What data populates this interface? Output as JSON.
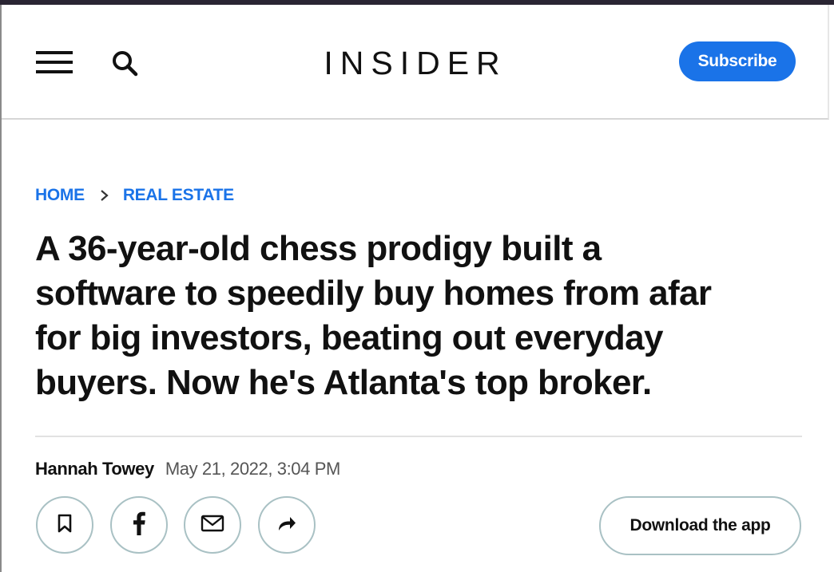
{
  "header": {
    "logo_text": "INSIDER",
    "subscribe_label": "Subscribe",
    "menu_icon": "hamburger-menu-icon",
    "search_icon": "search-icon"
  },
  "breadcrumb": {
    "items": [
      {
        "label": "HOME"
      },
      {
        "label": "REAL ESTATE"
      }
    ],
    "separator_icon": "chevron-right-icon"
  },
  "article": {
    "headline_lines": [
      "A 36-year-old chess prodigy built a",
      "software to speedily buy homes from afar",
      "for big investors, beating out everyday",
      "buyers. Now he's Atlanta's top broker."
    ],
    "author": "Hannah Towey",
    "date": "May 21, 2022, 3:04 PM"
  },
  "actions": {
    "buttons": [
      {
        "icon": "bookmark-icon"
      },
      {
        "icon": "facebook-icon"
      },
      {
        "icon": "email-icon"
      },
      {
        "icon": "share-icon"
      }
    ],
    "download_label": "Download the app"
  },
  "colors": {
    "accent_blue": "#1a73e8",
    "text_dark": "#111111",
    "text_muted": "#555555",
    "button_border": "#a9c1c4",
    "top_strip": "#2a2533"
  }
}
